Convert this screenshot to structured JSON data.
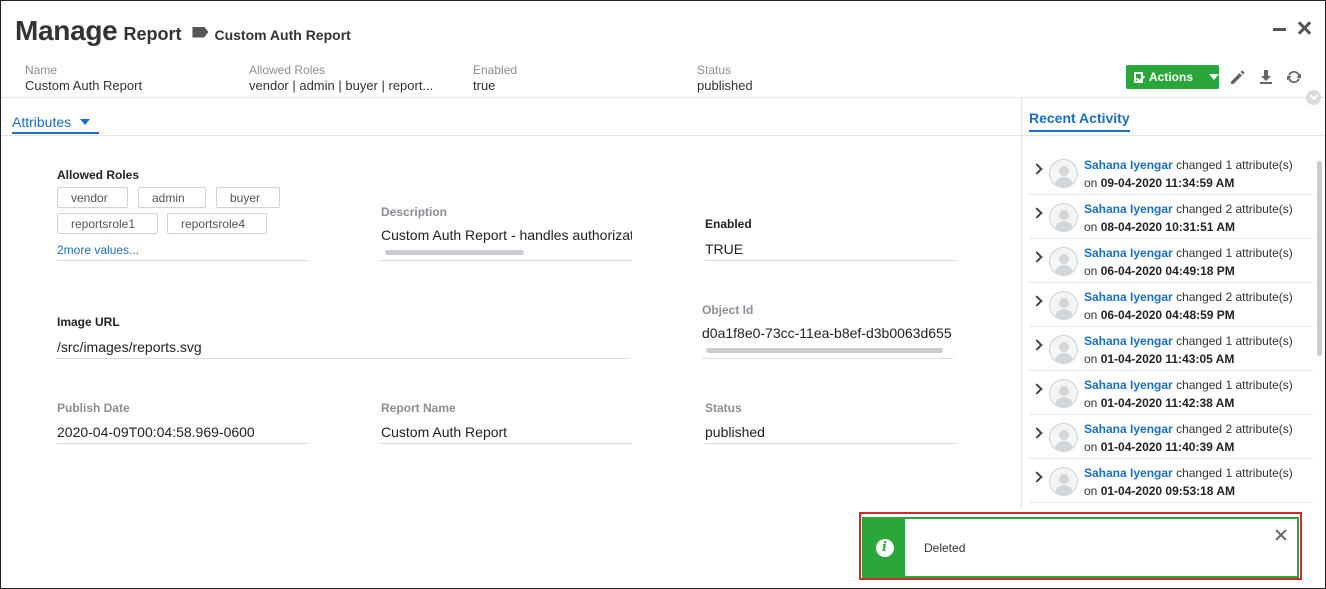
{
  "header": {
    "title_main": "Manage",
    "title_sub": "Report",
    "tag_label": "Custom Auth Report"
  },
  "summary": [
    {
      "label": "Name",
      "value": "Custom Auth Report"
    },
    {
      "label": "Allowed Roles",
      "value": "vendor | admin | buyer | report..."
    },
    {
      "label": "Enabled",
      "value": "true"
    },
    {
      "label": "Status",
      "value": "published"
    }
  ],
  "toolbar": {
    "actions_label": "Actions"
  },
  "tabs": {
    "attributes": "Attributes",
    "recent_activity": "Recent Activity"
  },
  "attributes": {
    "allowed_roles": {
      "label": "Allowed Roles",
      "chips": [
        "vendor",
        "admin",
        "buyer",
        "reportsrole1",
        "reportsrole4"
      ],
      "more": "2more values..."
    },
    "description": {
      "label": "Description",
      "value": "Custom Auth Report - handles authorizat"
    },
    "enabled": {
      "label": "Enabled",
      "value": "TRUE"
    },
    "image_url": {
      "label": "Image URL",
      "value": "/src/images/reports.svg"
    },
    "object_id": {
      "label": "Object Id",
      "value": "d0a1f8e0-73cc-11ea-b8ef-d3b0063d655"
    },
    "publish_date": {
      "label": "Publish Date",
      "value": "2020-04-09T00:04:58.969-0600"
    },
    "report_name": {
      "label": "Report Name",
      "value": "Custom Auth Report"
    },
    "status": {
      "label": "Status",
      "value": "published"
    }
  },
  "activity": {
    "on_word": "on",
    "items": [
      {
        "user": "Sahana Iyengar",
        "action": "changed 1 attribute(s)",
        "date": "09-04-2020 11:34:59 AM"
      },
      {
        "user": "Sahana Iyengar",
        "action": "changed 2 attribute(s)",
        "date": "08-04-2020 10:31:51 AM"
      },
      {
        "user": "Sahana Iyengar",
        "action": "changed 1 attribute(s)",
        "date": "06-04-2020 04:49:18 PM"
      },
      {
        "user": "Sahana Iyengar",
        "action": "changed 2 attribute(s)",
        "date": "06-04-2020 04:48:59 PM"
      },
      {
        "user": "Sahana Iyengar",
        "action": "changed 1 attribute(s)",
        "date": "01-04-2020 11:43:05 AM"
      },
      {
        "user": "Sahana Iyengar",
        "action": "changed 1 attribute(s)",
        "date": "01-04-2020 11:42:38 AM"
      },
      {
        "user": "Sahana Iyengar",
        "action": "changed 2 attribute(s)",
        "date": "01-04-2020 11:40:39 AM"
      },
      {
        "user": "Sahana Iyengar",
        "action": "changed 1 attribute(s)",
        "date": "01-04-2020 09:53:18 AM"
      }
    ]
  },
  "toast": {
    "message": "Deleted",
    "icon": "info-icon"
  },
  "colors": {
    "accent": "#1a6fc0",
    "success": "#2aa63a",
    "highlight": "#d32a2a"
  }
}
